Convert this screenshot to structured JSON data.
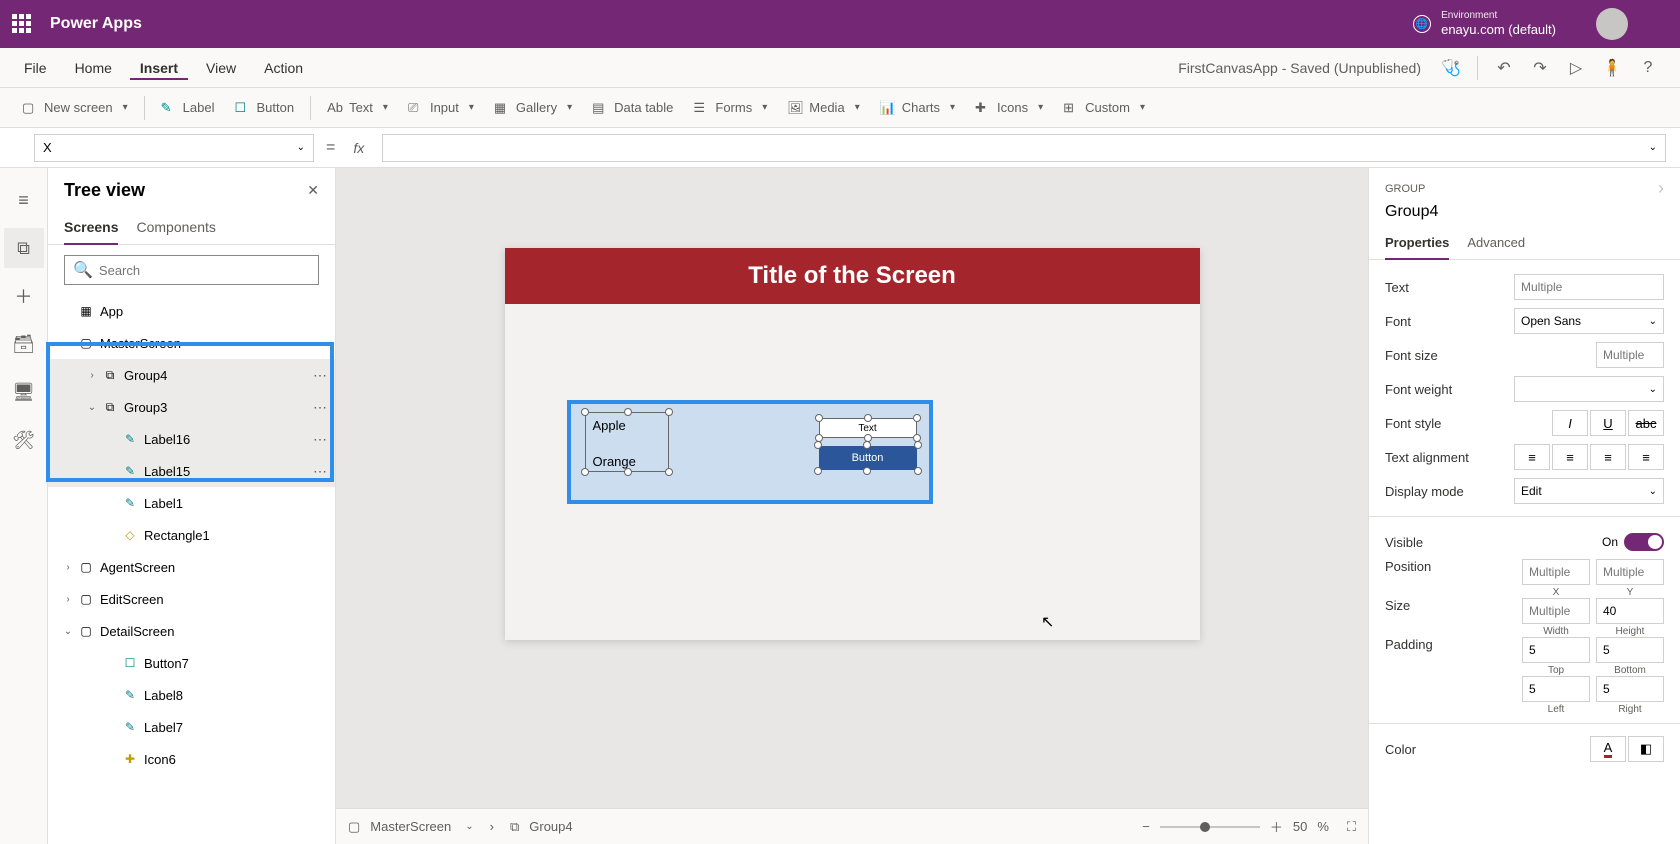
{
  "header": {
    "appName": "Power Apps",
    "envLabel": "Environment",
    "envName": "enayu.com (default)"
  },
  "menu": {
    "items": [
      "File",
      "Home",
      "Insert",
      "View",
      "Action"
    ],
    "activeIndex": 2,
    "docTitle": "FirstCanvasApp - Saved (Unpublished)"
  },
  "ribbon": {
    "newScreen": "New screen",
    "label": "Label",
    "button": "Button",
    "text": "Text",
    "input": "Input",
    "gallery": "Gallery",
    "dataTable": "Data table",
    "forms": "Forms",
    "media": "Media",
    "charts": "Charts",
    "icons": "Icons",
    "custom": "Custom"
  },
  "formulaBar": {
    "property": "X",
    "eq": "="
  },
  "tree": {
    "title": "Tree view",
    "tabs": {
      "screens": "Screens",
      "components": "Components"
    },
    "searchPlaceholder": "Search",
    "app": "App",
    "items": {
      "masterScreen": "MasterScreen",
      "group4": "Group4",
      "group3": "Group3",
      "label16": "Label16",
      "label15": "Label15",
      "label1": "Label1",
      "rectangle1": "Rectangle1",
      "agentScreen": "AgentScreen",
      "editScreen": "EditScreen",
      "detailScreen": "DetailScreen",
      "button7": "Button7",
      "label8": "Label8",
      "label7": "Label7",
      "icon6": "Icon6"
    }
  },
  "canvas": {
    "screenTitle": "Title of the Screen",
    "apple": "Apple",
    "orange": "Orange",
    "text": "Text",
    "button": "Button"
  },
  "status": {
    "screen": "MasterScreen",
    "selected": "Group4",
    "zoomValue": "50",
    "zoomPct": "%"
  },
  "props": {
    "type": "GROUP",
    "name": "Group4",
    "tabs": {
      "properties": "Properties",
      "advanced": "Advanced"
    },
    "labels": {
      "text": "Text",
      "font": "Font",
      "fontSize": "Font size",
      "fontWeight": "Font weight",
      "fontStyle": "Font style",
      "textAlign": "Text alignment",
      "displayMode": "Display mode",
      "visible": "Visible",
      "position": "Position",
      "size": "Size",
      "padding": "Padding",
      "color": "Color",
      "x": "X",
      "y": "Y",
      "width": "Width",
      "height": "Height",
      "top": "Top",
      "bottom": "Bottom",
      "left": "Left",
      "right": "Right",
      "on": "On"
    },
    "values": {
      "textPh": "Multiple",
      "font": "Open Sans",
      "fontSizePh": "Multiple",
      "displayMode": "Edit",
      "posXPh": "Multiple",
      "posYPh": "Multiple",
      "sizeWPh": "Multiple",
      "sizeH": "40",
      "padTop": "5",
      "padBottom": "5",
      "padLeft": "5",
      "padRight": "5"
    }
  }
}
